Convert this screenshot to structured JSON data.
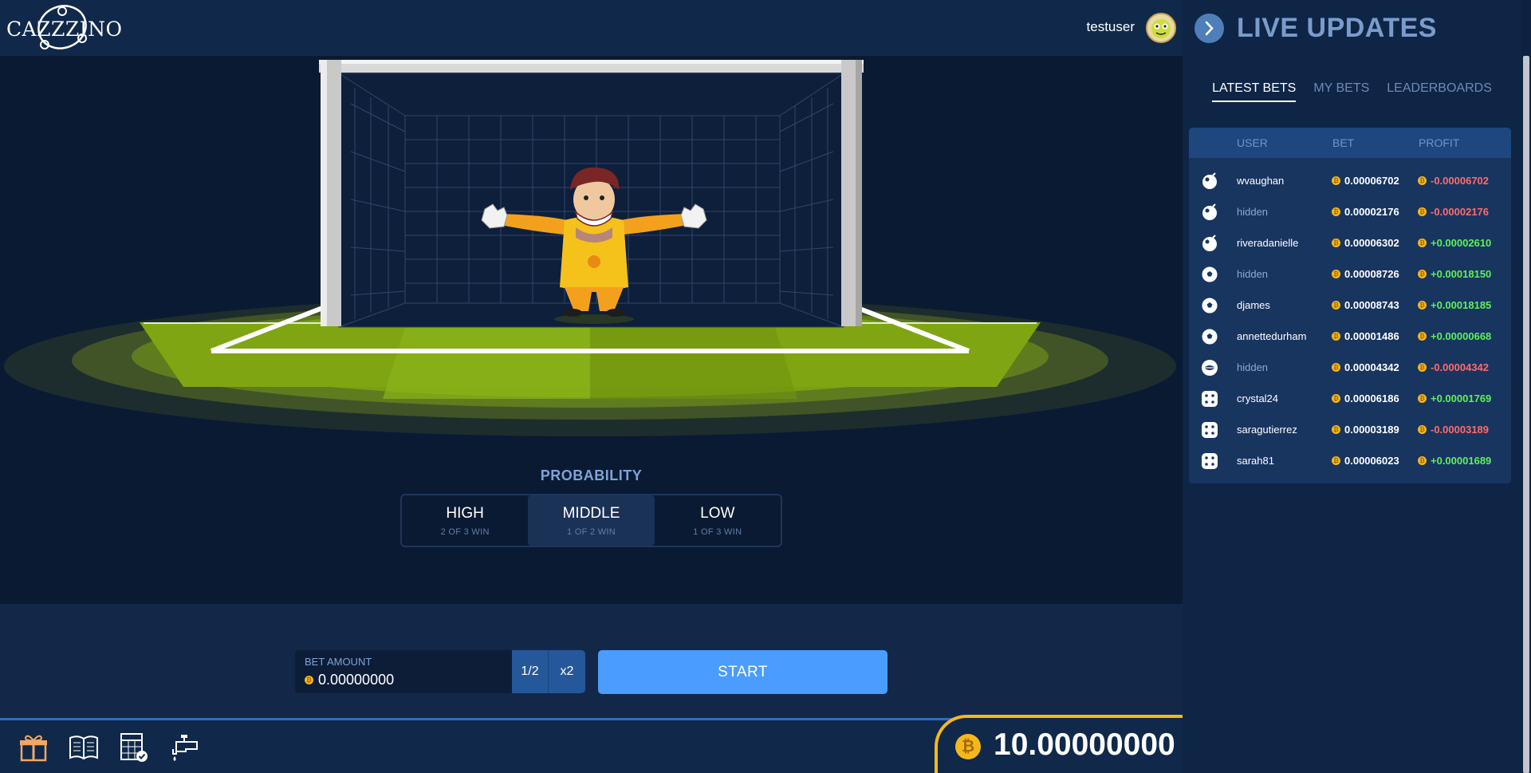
{
  "header": {
    "logo_text": "CAZZZINO",
    "username": "testuser"
  },
  "game": {
    "probability": {
      "title": "PROBABILITY",
      "options": [
        {
          "label": "HIGH",
          "sub": "2 OF 3 WIN",
          "active": false
        },
        {
          "label": "MIDDLE",
          "sub": "1 OF 2 WIN",
          "active": true
        },
        {
          "label": "LOW",
          "sub": "1 OF 3 WIN",
          "active": false
        }
      ]
    },
    "bet": {
      "label": "BET AMOUNT",
      "value": "0.00000000",
      "half_label": "1/2",
      "double_label": "x2",
      "start_label": "START"
    }
  },
  "footer": {
    "balance": "10.00000000",
    "coin_glyph": "₿",
    "tools": [
      "gift-icon",
      "book-icon",
      "calculator-check-icon",
      "faucet-icon"
    ]
  },
  "sidebar": {
    "title": "LIVE UPDATES",
    "tabs": [
      {
        "label": "LATEST BETS",
        "active": true
      },
      {
        "label": "MY BETS",
        "active": false
      },
      {
        "label": "LEADERBOARDS",
        "active": false
      }
    ],
    "columns": [
      "USER",
      "BET",
      "PROFIT"
    ],
    "rows": [
      {
        "icon": "bomb-icon",
        "user": "wvaughan",
        "hidden": false,
        "bet": "0.00006702",
        "profit": "-0.00006702",
        "positive": false
      },
      {
        "icon": "bomb-icon",
        "user": "hidden",
        "hidden": true,
        "bet": "0.00002176",
        "profit": "-0.00002176",
        "positive": false
      },
      {
        "icon": "bomb-icon",
        "user": "riveradanielle",
        "hidden": false,
        "bet": "0.00006302",
        "profit": "+0.00002610",
        "positive": true
      },
      {
        "icon": "soccer-ball-icon",
        "user": "hidden",
        "hidden": true,
        "bet": "0.00008726",
        "profit": "+0.00018150",
        "positive": true
      },
      {
        "icon": "soccer-ball-icon",
        "user": "djames",
        "hidden": false,
        "bet": "0.00008743",
        "profit": "+0.00018185",
        "positive": true
      },
      {
        "icon": "soccer-ball-icon",
        "user": "annettedurham",
        "hidden": false,
        "bet": "0.00001486",
        "profit": "+0.00000668",
        "positive": true
      },
      {
        "icon": "lips-icon",
        "user": "hidden",
        "hidden": true,
        "bet": "0.00004342",
        "profit": "-0.00004342",
        "positive": false
      },
      {
        "icon": "dice-icon",
        "user": "crystal24",
        "hidden": false,
        "bet": "0.00006186",
        "profit": "+0.00001769",
        "positive": true
      },
      {
        "icon": "dice-icon",
        "user": "saragutierrez",
        "hidden": false,
        "bet": "0.00003189",
        "profit": "-0.00003189",
        "positive": false
      },
      {
        "icon": "dice-icon",
        "user": "sarah81",
        "hidden": false,
        "bet": "0.00006023",
        "profit": "+0.00001689",
        "positive": true
      }
    ]
  },
  "colors": {
    "accent": "#4a9cff",
    "coin": "#f5b81c",
    "loss": "#ff6b6b",
    "win": "#5ef05a"
  }
}
